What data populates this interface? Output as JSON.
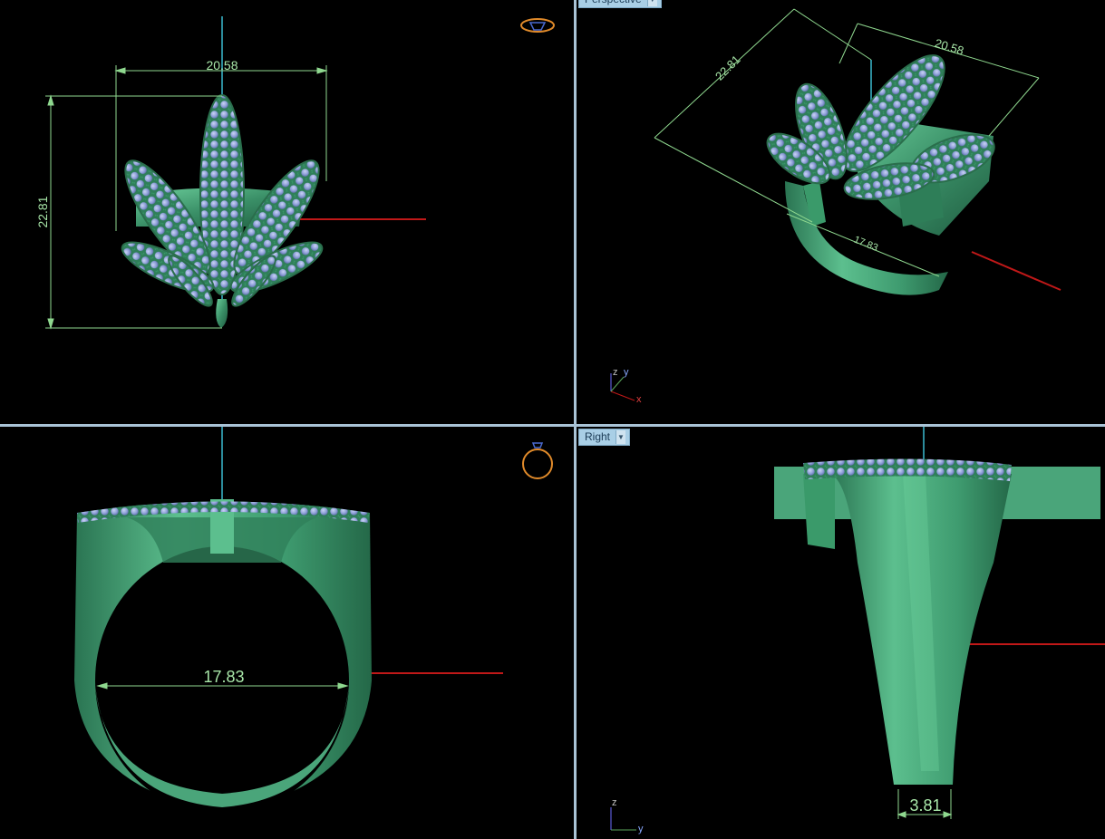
{
  "viewports": {
    "top": {
      "dim_width": "20.58",
      "dim_height": "22.81"
    },
    "perspective": {
      "label": "Perspective",
      "dim_a": "22.81",
      "dim_b": "20.58",
      "dim_c": "17.83"
    },
    "front": {
      "dim_inner": "17.83"
    },
    "right": {
      "label": "Right",
      "dim_shank": "3.81"
    }
  },
  "axes": {
    "persp": {
      "z": "z",
      "y": "y",
      "x": "x"
    },
    "right": {
      "z": "z",
      "y": "y"
    }
  },
  "icons": {
    "top_widget": "ring-top-icon",
    "front_widget": "ring-front-icon"
  },
  "colors": {
    "metal": "#3a8f67",
    "metal_light": "#5cbf8e",
    "stone": "#8e9fd8",
    "dimension": "#a8e6a8",
    "axis_x": "#c01818",
    "axis_z": "#2c8c9c",
    "label_bg": "#a9cfe6",
    "divider": "#a9c3d6"
  }
}
